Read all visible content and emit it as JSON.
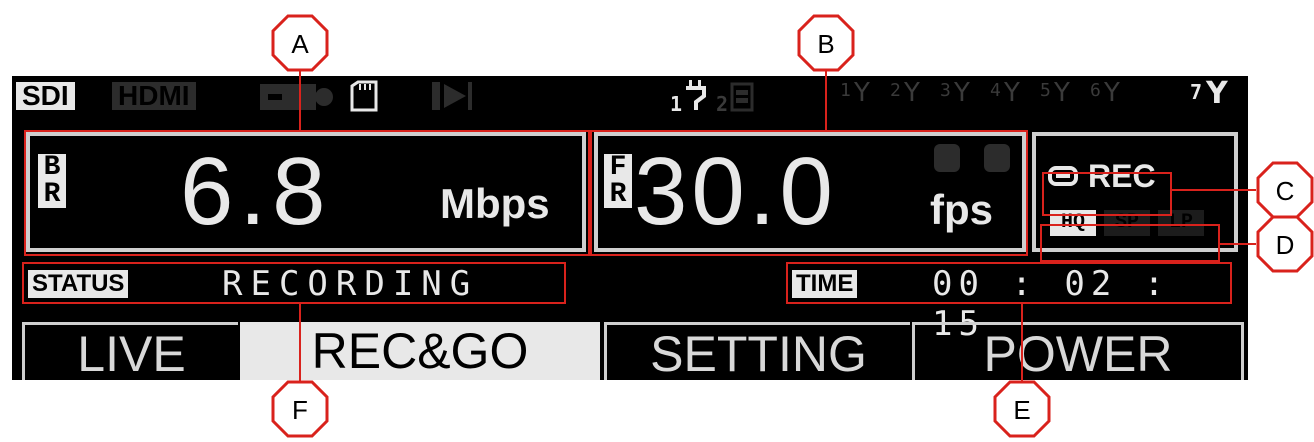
{
  "inputs": {
    "sdi": "SDI",
    "hdmi": "HDMI"
  },
  "channels": {
    "primary": "1",
    "secondary": "2",
    "antenna_labels": [
      "1",
      "2",
      "3",
      "4",
      "5",
      "6",
      "7"
    ]
  },
  "bitrate": {
    "tag_top": "B",
    "tag_bottom": "R",
    "value": "6.8",
    "unit": "Mbps"
  },
  "framerate": {
    "tag_top": "F",
    "tag_bottom": "R",
    "value": "30.0",
    "unit": "fps"
  },
  "record": {
    "label": "REC",
    "qualities": [
      "HQ",
      "SP",
      "LP"
    ],
    "selected_quality": "HQ"
  },
  "status": {
    "label": "STATUS",
    "value": "RECORDING"
  },
  "time": {
    "label": "TIME",
    "value": "00:02:15"
  },
  "tabs": [
    {
      "label": "LIVE"
    },
    {
      "label": "REC&GO",
      "selected": true
    },
    {
      "label": "SETTING"
    },
    {
      "label": "POWER"
    }
  ],
  "callouts": [
    "A",
    "B",
    "C",
    "D",
    "E",
    "F"
  ],
  "colors": {
    "callout_red": "#d9221c",
    "lcd_bg": "#000000",
    "lcd_fg": "#e8e8e8",
    "lcd_dim": "#3a3a3a"
  },
  "icons": [
    "tape-icon",
    "sd-card-icon",
    "play-icon",
    "usb-plug-icon",
    "battery-icon",
    "antenna-icon"
  ]
}
